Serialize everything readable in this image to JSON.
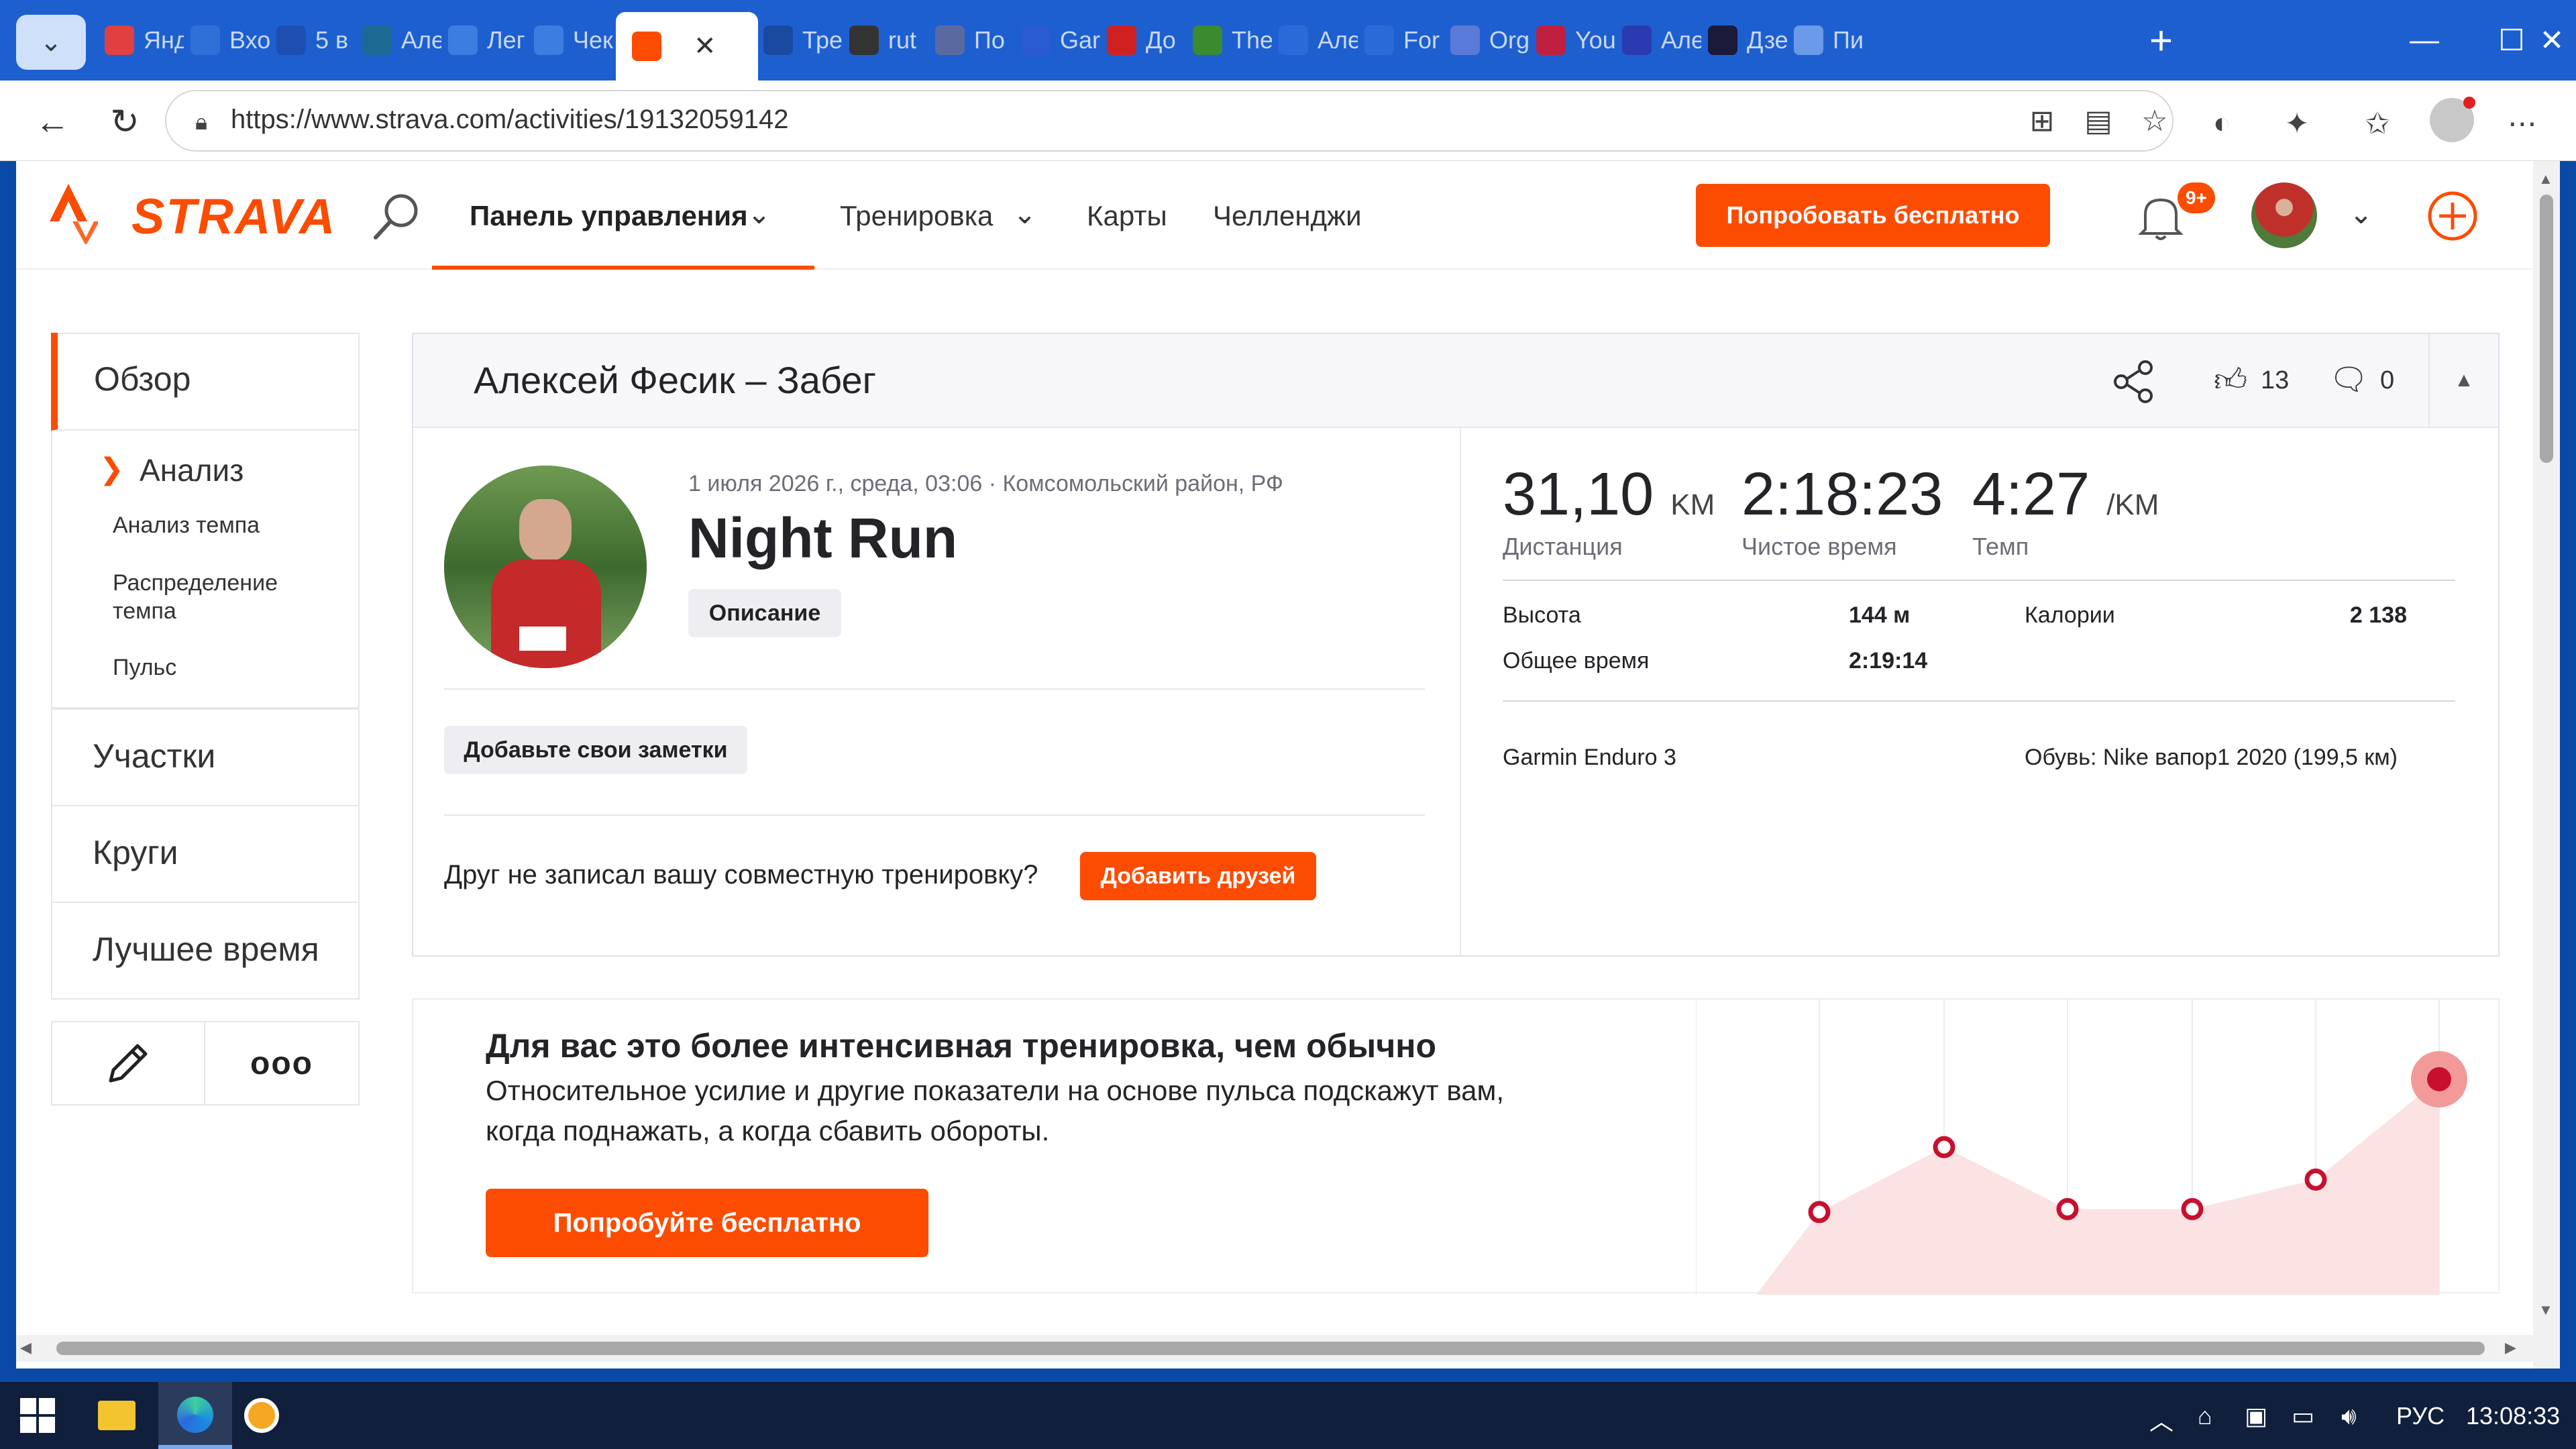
{
  "browser": {
    "tabs": [
      {
        "label": "Янд",
        "icon": "map-pin-icon",
        "color": "#e04040"
      },
      {
        "label": "Вхо",
        "icon": "mail-icon",
        "color": "#2f6fd8"
      },
      {
        "label": "5 в",
        "icon": "b-icon",
        "color": "#1e4fb0"
      },
      {
        "label": "Але",
        "icon": "runner-icon",
        "color": "#1b6a94"
      },
      {
        "label": "Лег",
        "icon": "sb-icon",
        "color": "#3b7de0"
      },
      {
        "label": "Чек",
        "icon": "sb-icon",
        "color": "#3b7de0"
      },
      {
        "label": "",
        "icon": "strava-icon",
        "color": "#fc4c02"
      },
      {
        "label": "Тре",
        "icon": "drop-icon",
        "color": "#1a4aa0"
      },
      {
        "label": "rut",
        "icon": "lock-icon",
        "color": "#333"
      },
      {
        "label": "По",
        "icon": "globe-icon",
        "color": "#5a6aa0"
      },
      {
        "label": "Gar",
        "icon": "triangle-icon",
        "color": "#2a5bd0"
      },
      {
        "label": "До",
        "icon": "red-square-icon",
        "color": "#d02020"
      },
      {
        "label": "The",
        "icon": "green-circle-icon",
        "color": "#3a8a30"
      },
      {
        "label": "Але",
        "icon": "vk-icon",
        "color": "#2a6ad8"
      },
      {
        "label": "For",
        "icon": "vk-icon",
        "color": "#2a6ad8"
      },
      {
        "label": "Org",
        "icon": "check-icon",
        "color": "#5a7ad8"
      },
      {
        "label": "You",
        "icon": "youtube-icon",
        "color": "#c02040"
      },
      {
        "label": "Але",
        "icon": "r-icon",
        "color": "#2a3ab0"
      },
      {
        "label": "Дзе",
        "icon": "star-icon",
        "color": "#1a1a3a"
      },
      {
        "label": "Пи",
        "icon": "wave-icon",
        "color": "#6a9ae8"
      }
    ],
    "active_tab_close": "✕",
    "new_tab": "+",
    "url": "https://www.strava.com/activities/19132059142"
  },
  "strava": {
    "logo": "STRAVA",
    "nav": {
      "dashboard": "Панель управления",
      "training": "Тренировка",
      "maps": "Карты",
      "challenges": "Челленджи"
    },
    "try_free_button": "Попробовать бесплатно",
    "notifications_badge": "9+"
  },
  "sidebar": {
    "overview": "Обзор",
    "analysis": "Анализ",
    "pace_analysis": "Анализ темпа",
    "pace_distribution": "Распределение темпа",
    "heart_rate": "Пульс",
    "segments": "Участки",
    "laps": "Круги",
    "best_efforts": "Лучшее время",
    "more_dots": "ooo"
  },
  "activity": {
    "header_title": "Алексей Фесик – Забег",
    "kudos_count": "13",
    "comments_count": "0",
    "date_location": "1 июля 2026 г., среда, 03:06 · Комсомольский район, РФ",
    "name": "Night Run",
    "description_button": "Описание",
    "notes_button": "Добавьте свои заметки",
    "friend_prompt": "Друг не записал вашу совместную тренировку?",
    "add_friends_button": "Добавить друзей",
    "stats": {
      "distance_value": "31,10",
      "distance_unit": "KM",
      "distance_label": "Дистанция",
      "moving_time_value": "2:18:23",
      "moving_time_label": "Чистое время",
      "pace_value": "4:27",
      "pace_unit": "/KM",
      "pace_label": "Темп",
      "elevation_label": "Высота",
      "elevation_value": "144 м",
      "calories_label": "Калории",
      "calories_value": "2 138",
      "elapsed_label": "Общее время",
      "elapsed_value": "2:19:14",
      "device": "Garmin Enduro 3",
      "shoes": "Обувь: Nike вапор1 2020 (199,5 км)"
    }
  },
  "promo": {
    "title": "Для вас это более интенсивная тренировка, чем обычно",
    "text_line1": "Относительное усилие и другие показатели на основе пульса подскажут вам,",
    "text_line2": "когда поднажать, а когда сбавить обороты.",
    "button": "Попробуйте бесплатно"
  },
  "chart_data": {
    "type": "area",
    "values": [
      0.28,
      0.5,
      0.29,
      0.29,
      0.39,
      0.73
    ],
    "highlight_index": 5,
    "colors": {
      "fill": "#fbe3e3",
      "point": "#c8102e",
      "highlight_ring": "#f29a9a"
    }
  },
  "taskbar": {
    "lang": "РУС",
    "time": "13:08:33"
  }
}
